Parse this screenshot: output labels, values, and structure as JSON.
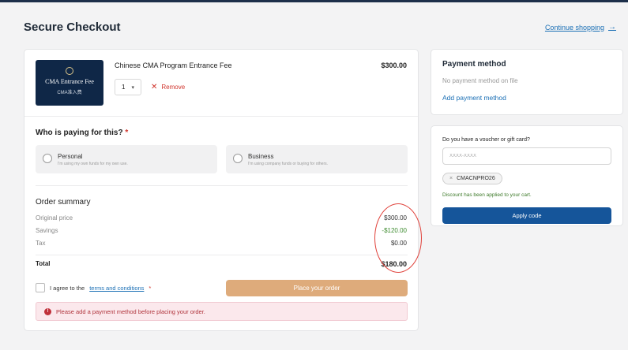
{
  "header": {
    "title": "Secure Checkout",
    "continue_label": "Continue shopping",
    "continue_arrow": "→"
  },
  "cart_item": {
    "thumbnail_title": "CMA Entrance Fee",
    "thumbnail_subtitle": "CMA准入费",
    "name": "Chinese CMA Program Entrance Fee",
    "price": "$300.00",
    "quantity": "1",
    "remove_label": "Remove"
  },
  "payer": {
    "title": "Who is paying for this?",
    "required_mark": "*",
    "options": [
      {
        "label": "Personal",
        "description": "I'm using my own funds for my own use."
      },
      {
        "label": "Business",
        "description": "I'm using company funds or buying for others."
      }
    ]
  },
  "order_summary": {
    "title": "Order summary",
    "rows": [
      {
        "label": "Original price",
        "value": "$300.00"
      },
      {
        "label": "Savings",
        "value": "-$120.00"
      },
      {
        "label": "Tax",
        "value": "$0.00"
      }
    ],
    "total_label": "Total",
    "total_value": "$180.00"
  },
  "agreement": {
    "prefix": "I agree to the",
    "link": "terms and conditions",
    "required_mark": "*"
  },
  "place_order_label": "Place your order",
  "alert": {
    "icon": "!",
    "text": "Please add a payment method before placing your order."
  },
  "payment_method": {
    "title": "Payment method",
    "empty_text": "No payment method on file",
    "add_label": "Add payment method"
  },
  "voucher": {
    "label": "Do you have a voucher or gift card?",
    "placeholder": "XXXX-XXXX",
    "applied_code": "CMACNPRO26",
    "chip_remove": "×",
    "message": "Discount has been applied to your cart.",
    "apply_label": "Apply code"
  },
  "colors": {
    "place_order_button": "#deab7b",
    "apply_button": "#15559a",
    "savings_text": "#3d8b2f",
    "highlight_circle": "#e0413a"
  }
}
